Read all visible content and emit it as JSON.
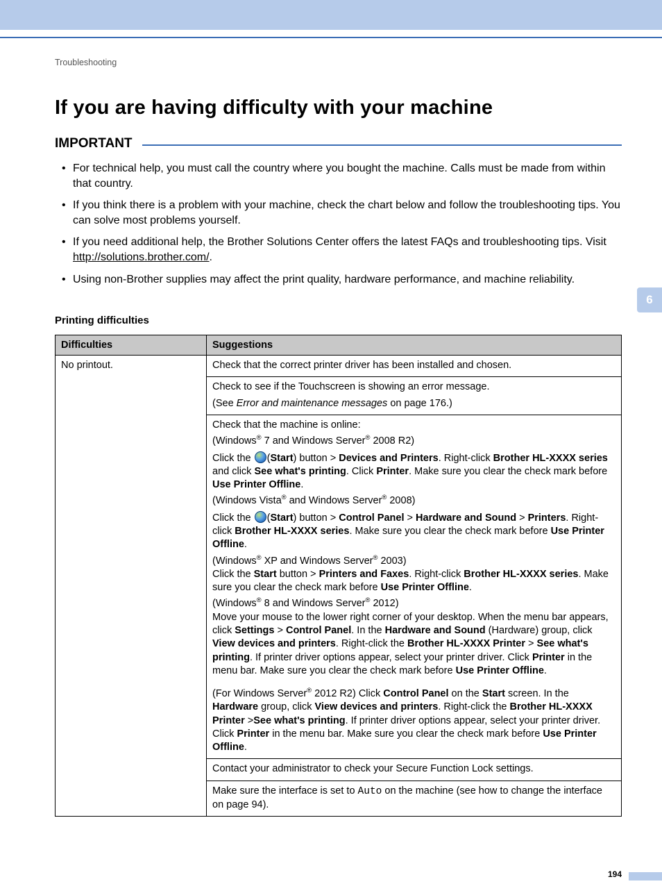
{
  "header": {
    "breadcrumb": "Troubleshooting"
  },
  "title": "If you are having difficulty with your machine",
  "important": {
    "label": "IMPORTANT",
    "items": [
      {
        "text": "For technical help, you must call the country where you bought the machine. Calls must be made from within that country."
      },
      {
        "text": "If you think there is a problem with your machine, check the chart below and follow the troubleshooting tips. You can solve most problems yourself."
      },
      {
        "pre": "If you need additional help, the Brother Solutions Center offers the latest FAQs and troubleshooting tips. Visit ",
        "link": "http://solutions.brother.com/",
        "post": "."
      },
      {
        "text": "Using non-Brother supplies may affect the print quality, hardware performance, and machine reliability."
      }
    ]
  },
  "section_title": "Printing difficulties",
  "table": {
    "headers": {
      "col1": "Difficulties",
      "col2": "Suggestions"
    },
    "difficulty": "No printout.",
    "rows": {
      "r1": "Check that the correct printer driver has been installed and chosen.",
      "r2a": "Check to see if the Touchscreen is showing an error message.",
      "r2b_pre": "(See ",
      "r2b_italic": "Error and maintenance messages",
      "r2b_post": " on page 176.)",
      "r3": {
        "line1": "Check that the machine is online:",
        "win7": {
          "pre": "(Windows",
          "mid": " 7 and Windows Server",
          "post": " 2008 R2)"
        },
        "win7_body": {
          "a": "Click the ",
          "b": "(",
          "c": "Start",
          "d": ") button > ",
          "e": "Devices and Printers",
          "f": ". Right-click ",
          "g": "Brother HL-XXXX series",
          "h": " and click ",
          "i": "See what's printing",
          "j": ". Click ",
          "k": "Printer",
          "l": ". Make sure you clear the check mark before ",
          "m": "Use Printer Offline",
          "n": "."
        },
        "vista": {
          "pre": "(Windows Vista",
          "mid": " and Windows Server",
          "post": " 2008)"
        },
        "vista_body": {
          "a": "Click the ",
          "b": "(",
          "c": "Start",
          "d": ") button > ",
          "e": "Control Panel",
          "f": " > ",
          "g": "Hardware and Sound",
          "h": " > ",
          "i": "Printers",
          "j": ". Right-click ",
          "k": "Brother HL-XXXX series",
          "l": ". Make sure you clear the check mark before ",
          "m": "Use Printer Offline",
          "n": "."
        },
        "xp": {
          "pre": "(Windows",
          "mid": " XP and Windows Server",
          "post": " 2003)"
        },
        "xp_body": {
          "a": "Click the ",
          "b": "Start",
          "c": " button > ",
          "d": "Printers and Faxes",
          "e": ". Right-click ",
          "f": "Brother HL-XXXX series",
          "g": ". Make sure you clear the check mark before ",
          "h": "Use Printer Offline",
          "i": "."
        },
        "win8": {
          "pre": "(Windows",
          "mid": " 8 and Windows Server",
          "post": " 2012)"
        },
        "win8_body": {
          "a": "Move your mouse to the lower right corner of your desktop. When the menu bar appears, click ",
          "b": "Settings",
          "c": " > ",
          "d": "Control Panel",
          "e": ". In the ",
          "f": "Hardware and Sound",
          "g": " (Hardware) group, click ",
          "h": "View devices and printers",
          "i": ". Right-click the ",
          "j": "Brother HL-XXXX Printer",
          "k": " > ",
          "l": "See what's printing",
          "m": ". If printer driver options appear, select your printer driver. Click ",
          "n": "Printer",
          "o": " in the menu bar. Make sure you clear the check mark before ",
          "p": "Use Printer Offline",
          "q": "."
        },
        "ws2012r2": {
          "a": "(For Windows Server",
          "b": " 2012 R2)  Click ",
          "c": "Control Panel",
          "d": " on the ",
          "e": "Start",
          "f": " screen. In the ",
          "g": "Hardware",
          "h": " group, click ",
          "i": "View devices and printers",
          "j": ". Right-click the ",
          "k": "Brother HL-XXXX Printer",
          "l": " >",
          "m": "See what's printing",
          "n": ". If printer driver options appear, select your printer driver. Click ",
          "o": "Printer",
          "p": " in the menu bar. Make sure you clear the check mark before ",
          "q": "Use Printer Offline",
          "r": "."
        }
      },
      "r4": "Contact your administrator to check your Secure Function Lock settings.",
      "r5": {
        "a": "Make sure the interface is set to ",
        "b": "Auto",
        "c": " on the machine (see how to change the interface on page 94)."
      }
    }
  },
  "side_tab": "6",
  "page_number": "194"
}
